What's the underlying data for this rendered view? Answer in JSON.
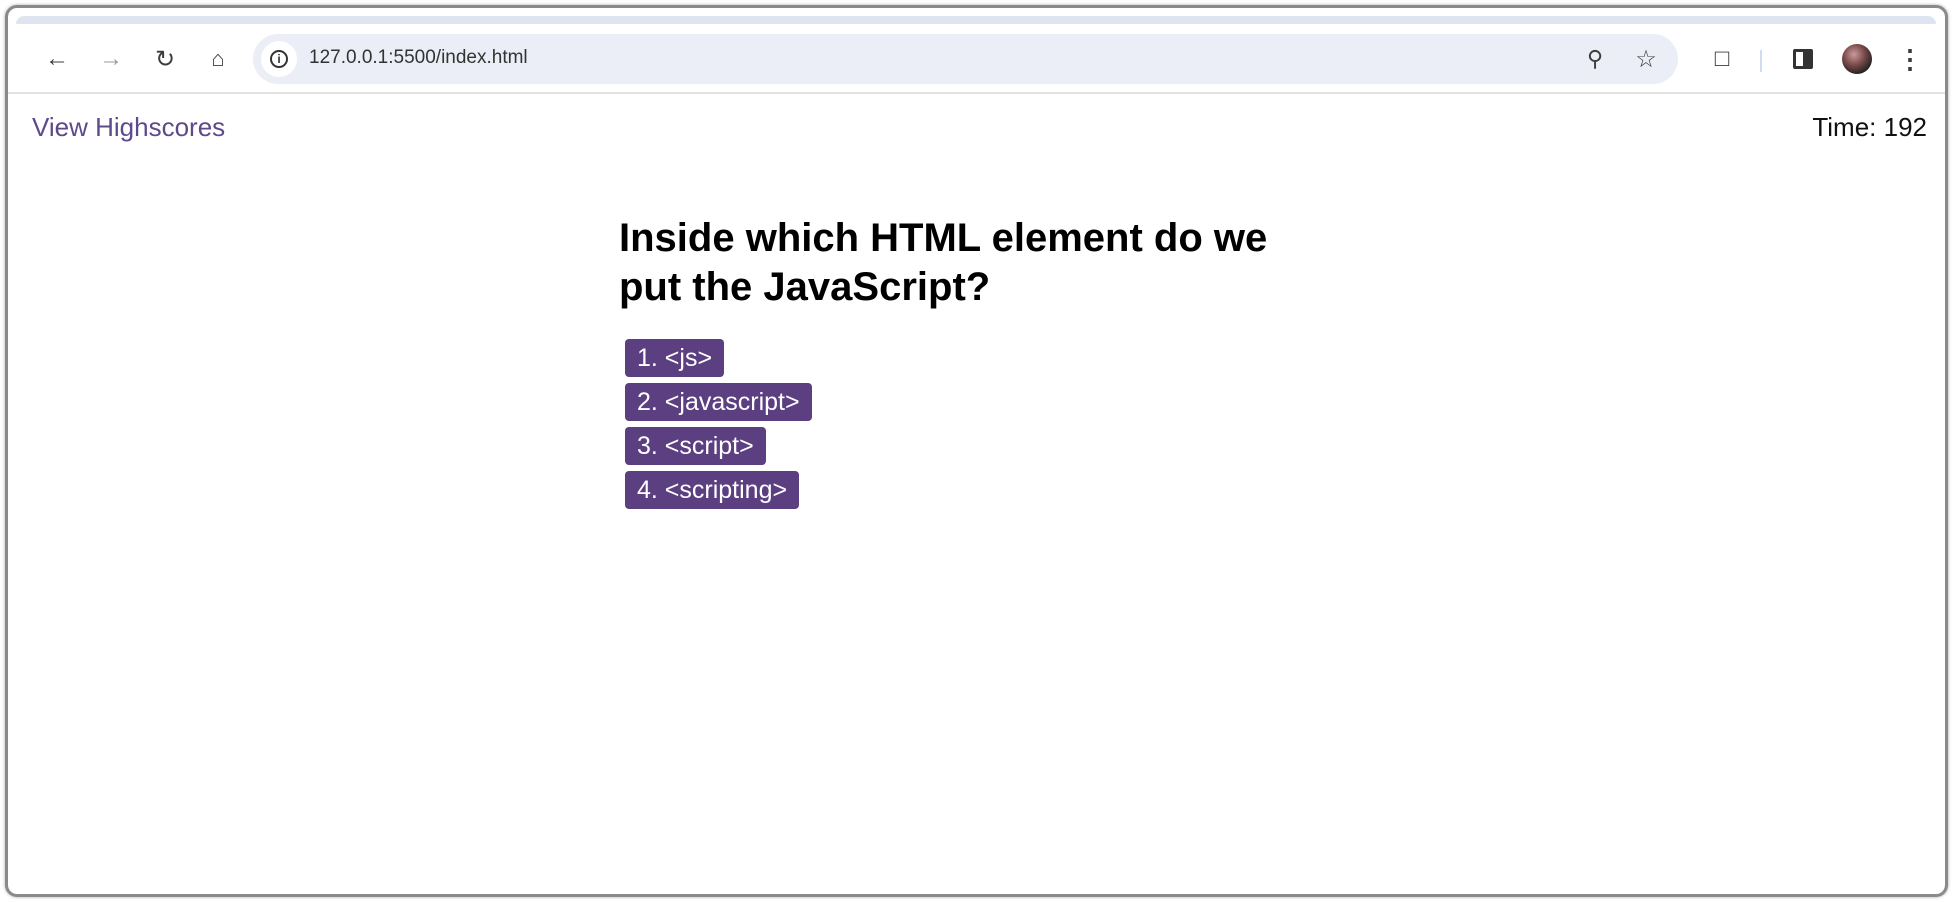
{
  "browser": {
    "url": "127.0.0.1:5500/index.html",
    "icons": [
      "back-icon",
      "forward-icon",
      "reload-icon",
      "home-icon",
      "site-info-icon",
      "zoom-icon",
      "bookmark-star-icon",
      "extensions-icon",
      "side-panel-icon",
      "profile-avatar",
      "menu-icon"
    ]
  },
  "header": {
    "highscores_link": "View Highscores",
    "time_label": "Time: 192"
  },
  "quiz": {
    "question": "Inside which HTML element do we put the JavaScript?",
    "choices": [
      "1. <js>",
      "2. <javascript>",
      "3. <script>",
      "4. <scripting>"
    ]
  },
  "colors": {
    "accent": "#5b3f80",
    "link": "#5c4a8c"
  }
}
